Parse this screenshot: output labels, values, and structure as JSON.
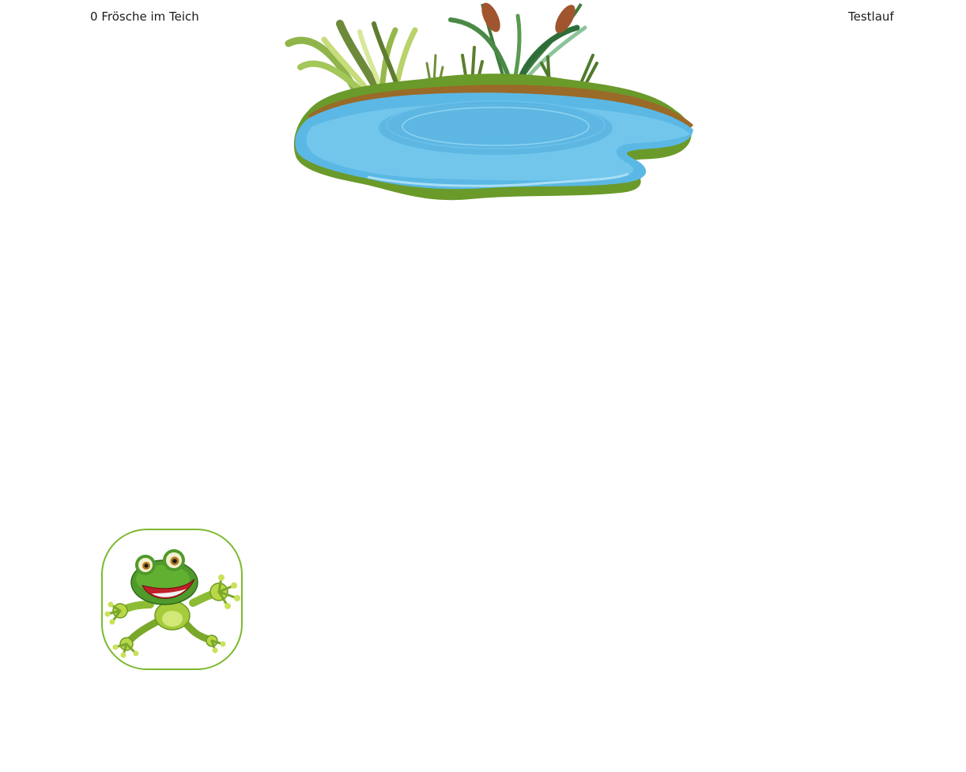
{
  "hud": {
    "count": "0",
    "pond_label": "Frösche im Teich",
    "mode_label": "Testlauf"
  },
  "pond": {
    "icon": "pond-icon"
  },
  "frog": {
    "icon": "frog-icon",
    "border_color": "#7cb82f"
  },
  "colors": {
    "water": "#5bb8e4",
    "grass": "#6a9a2a",
    "mud": "#9a6a28",
    "cattail": "#a0552e"
  }
}
